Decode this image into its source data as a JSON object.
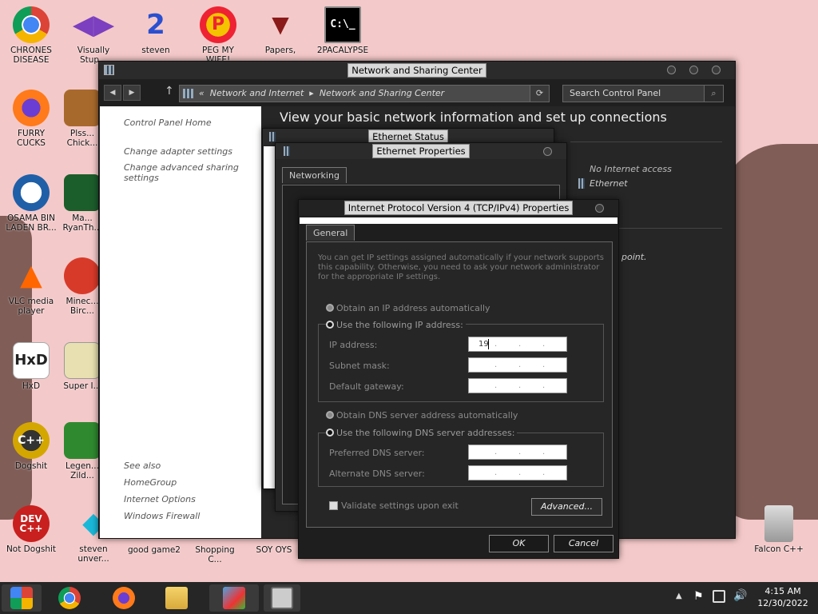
{
  "desktop": {
    "icons": [
      {
        "label": "CHRONES\nDISEASE",
        "icon": "chrome-icon"
      },
      {
        "label": "Visually\nStup...",
        "icon": "visual-studio-icon"
      },
      {
        "label": "steven",
        "icon": "steven-icon"
      },
      {
        "label": "PEG MY WIFE!",
        "icon": "p-icon"
      },
      {
        "label": "Papers,",
        "icon": "papers-please-icon"
      },
      {
        "label": "2PACALYPSE",
        "icon": "cmd-icon"
      },
      {
        "label": "FURRY CUCKS",
        "icon": "firefox-icon"
      },
      {
        "label": "Plss...\nChick...",
        "icon": "game-icon"
      },
      {
        "label": "OSAMA BIN\nLADEN BR...",
        "icon": "obama-logo-icon"
      },
      {
        "label": "Ma...\nRyanTh...",
        "icon": "angry-birds-space-icon"
      },
      {
        "label": "VLC media\nplayer",
        "icon": "vlc-icon"
      },
      {
        "label": "Minec...\nBirc...",
        "icon": "angry-birds-icon"
      },
      {
        "label": "HxD",
        "icon": "hxd-icon"
      },
      {
        "label": "Super I...",
        "icon": "super-icon"
      },
      {
        "label": "Dogshit",
        "icon": "codeblocks-icon"
      },
      {
        "label": "Legen...\nZild...",
        "icon": "zelda-icon"
      },
      {
        "label": "Not Dogshit",
        "icon": "devcpp-icon"
      },
      {
        "label": "steven\nunver...",
        "icon": "gem-icon"
      },
      {
        "label": "good game2",
        "icon": "none"
      },
      {
        "label": "Shopping C...",
        "icon": "none"
      },
      {
        "label": "SOY OYS",
        "icon": "none"
      },
      {
        "label": "Falcon C++",
        "icon": "recycle-bin-icon"
      }
    ]
  },
  "control_panel": {
    "title": "Network and Sharing Center",
    "breadcrumb_sep": "«",
    "breadcrumb_1": "Network and Internet",
    "breadcrumb_arrow": "▸",
    "breadcrumb_2": "Network and Sharing Center",
    "search_placeholder": "Search Control Panel",
    "heading": "View your basic network information and set up connections",
    "side_links": [
      "Control Panel Home",
      "Change adapter settings",
      "Change advanced sharing\nsettings"
    ],
    "see_also_title": "See also",
    "see_also": [
      "HomeGroup",
      "Internet Options",
      "Windows Firewall"
    ],
    "no_internet": "No Internet access",
    "ethernet": "Ethernet",
    "point_text": "point."
  },
  "ethernet_status": {
    "title": "Ethernet Status"
  },
  "ethernet_properties": {
    "title": "Ethernet Properties",
    "tab": "Networking"
  },
  "ipv4": {
    "title": "Internet Protocol Version 4 (TCP/IPv4) Properties",
    "tab": "General",
    "intro": "You can get IP settings assigned automatically if your network supports\nthis capability. Otherwise, you need to ask your network administrator\nfor the appropriate IP settings.",
    "obtain_ip_auto": "Obtain an IP address automatically",
    "use_following_ip": "Use the following IP address:",
    "ip_address_label": "IP address:",
    "ip_address_value": "19",
    "subnet_label": "Subnet mask:",
    "gateway_label": "Default gateway:",
    "obtain_dns_auto": "Obtain DNS server address automatically",
    "use_following_dns": "Use the following DNS server addresses:",
    "preferred_dns_label": "Preferred DNS server:",
    "alternate_dns_label": "Alternate DNS server:",
    "validate_label": "Validate settings upon exit",
    "advanced_button": "Advanced...",
    "ok_button": "OK",
    "cancel_button": "Cancel"
  },
  "taskbar": {
    "time": "4:15 AM",
    "date": "12/30/2022"
  }
}
